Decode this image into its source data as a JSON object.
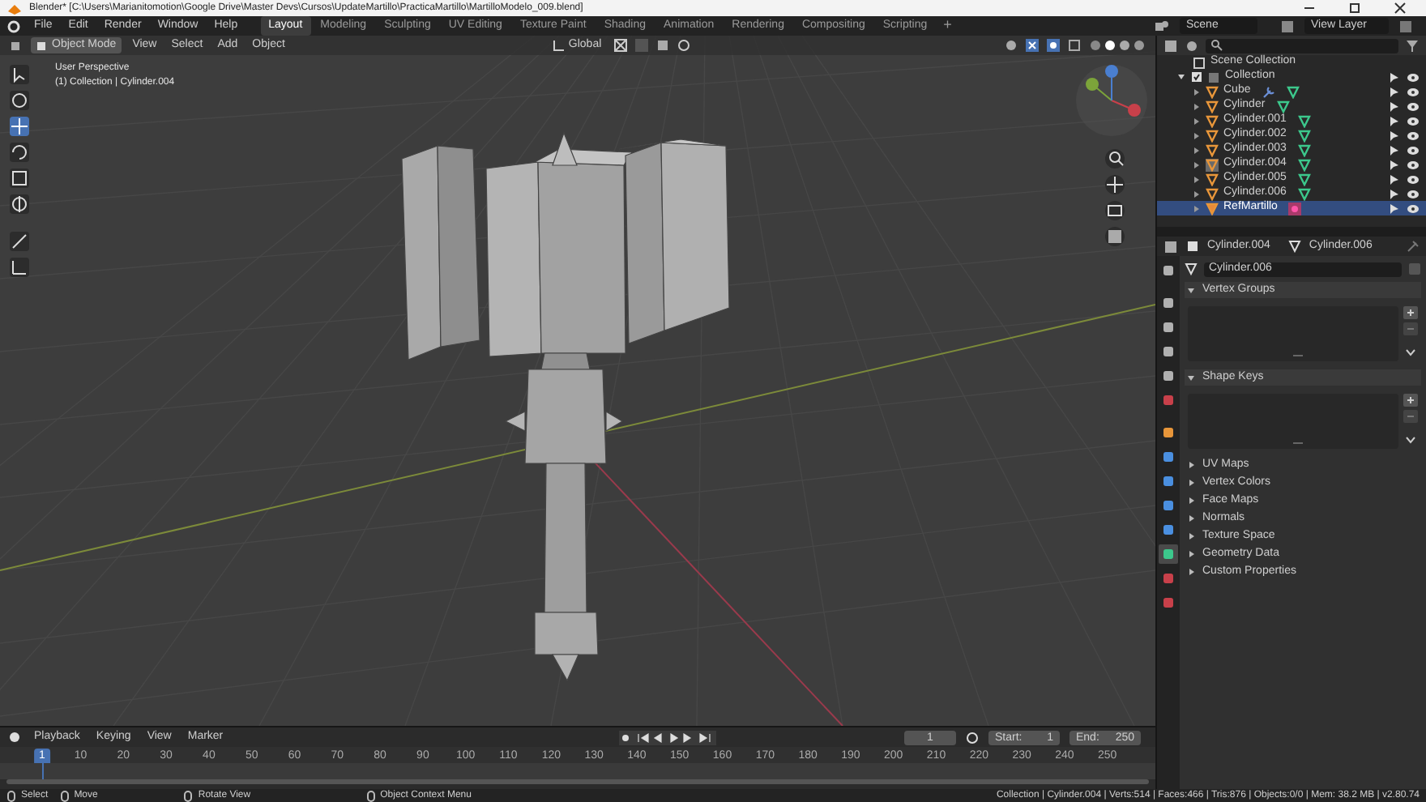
{
  "window": {
    "title": "Blender* [C:\\Users\\Marianitomotion\\Google Drive\\Master Devs\\Cursos\\UpdateMartillo\\PracticaMartillo\\MartilloModelo_009.blend]"
  },
  "menu": [
    "File",
    "Edit",
    "Render",
    "Window",
    "Help"
  ],
  "workspaces": [
    {
      "label": "Layout",
      "selected": true
    },
    {
      "label": "Modeling",
      "selected": false
    },
    {
      "label": "Sculpting",
      "selected": false
    },
    {
      "label": "UV Editing",
      "selected": false
    },
    {
      "label": "Texture Paint",
      "selected": false
    },
    {
      "label": "Shading",
      "selected": false
    },
    {
      "label": "Animation",
      "selected": false
    },
    {
      "label": "Rendering",
      "selected": false
    },
    {
      "label": "Compositing",
      "selected": false
    },
    {
      "label": "Scripting",
      "selected": false
    }
  ],
  "add_workspace": "+",
  "scene": "Scene",
  "view_layer": "View Layer",
  "viewport": {
    "mode": "Object Mode",
    "menus": [
      "View",
      "Select",
      "Add",
      "Object"
    ],
    "orientation": "Global",
    "overlay_lines": [
      "User Perspective",
      "(1) Collection | Cylinder.004"
    ],
    "tools": [
      {
        "selected": false
      },
      {
        "selected": false
      },
      {
        "selected": true
      },
      {
        "selected": false
      },
      {
        "selected": false
      },
      {
        "selected": false
      },
      {
        "selected": false
      },
      {
        "selected": false
      }
    ]
  },
  "outliner": {
    "root": "Scene Collection",
    "collection": "Collection",
    "items": [
      {
        "label": "Cube",
        "modifier": true,
        "active": false,
        "selected": false
      },
      {
        "label": "Cylinder",
        "modifier": false,
        "active": false,
        "selected": false
      },
      {
        "label": "Cylinder.001",
        "modifier": false,
        "active": false,
        "selected": false
      },
      {
        "label": "Cylinder.002",
        "modifier": false,
        "active": false,
        "selected": false
      },
      {
        "label": "Cylinder.003",
        "modifier": false,
        "active": false,
        "selected": false
      },
      {
        "label": "Cylinder.004",
        "modifier": false,
        "active": true,
        "selected": false
      },
      {
        "label": "Cylinder.005",
        "modifier": false,
        "active": false,
        "selected": false
      },
      {
        "label": "Cylinder.006",
        "modifier": false,
        "active": false,
        "selected": false
      },
      {
        "label": "RefMartillo",
        "modifier": false,
        "active": false,
        "selected": true
      }
    ]
  },
  "properties": {
    "breadcrumb": [
      "Cylinder.004",
      "Cylinder.006"
    ],
    "data_name": "Cylinder.006",
    "tabs": [
      {
        "color": "#b0b0b0",
        "selected": false
      },
      {
        "color": "#b0b0b0",
        "selected": false
      },
      {
        "color": "#b0b0b0",
        "selected": false
      },
      {
        "color": "#b0b0b0",
        "selected": false
      },
      {
        "color": "#b0b0b0",
        "selected": false
      },
      {
        "color": "#c8404a",
        "selected": false
      },
      {
        "color": "#e8963a",
        "selected": false
      },
      {
        "color": "#4a8fe0",
        "selected": false
      },
      {
        "color": "#4a8fe0",
        "selected": false
      },
      {
        "color": "#4a8fe0",
        "selected": false
      },
      {
        "color": "#4a8fe0",
        "selected": false
      },
      {
        "color": "#3cc88c",
        "selected": true
      },
      {
        "color": "#c8404a",
        "selected": false
      },
      {
        "color": "#c8404a",
        "selected": false
      }
    ],
    "panels": [
      {
        "label": "Vertex Groups",
        "expanded": true
      },
      {
        "label": "Shape Keys",
        "expanded": true
      },
      {
        "label": "UV Maps",
        "expanded": false
      },
      {
        "label": "Vertex Colors",
        "expanded": false
      },
      {
        "label": "Face Maps",
        "expanded": false
      },
      {
        "label": "Normals",
        "expanded": false
      },
      {
        "label": "Texture Space",
        "expanded": false
      },
      {
        "label": "Geometry Data",
        "expanded": false
      },
      {
        "label": "Custom Properties",
        "expanded": false
      }
    ]
  },
  "timeline": {
    "menus": [
      "Playback",
      "Keying",
      "View",
      "Marker"
    ],
    "current_frame": "1",
    "start_label": "Start:",
    "start": "1",
    "end_label": "End:",
    "end": "250",
    "ticks": [
      "1",
      "10",
      "20",
      "30",
      "40",
      "50",
      "60",
      "70",
      "80",
      "90",
      "100",
      "110",
      "120",
      "130",
      "140",
      "150",
      "160",
      "170",
      "180",
      "190",
      "200",
      "210",
      "220",
      "230",
      "240",
      "250"
    ]
  },
  "status_bar": {
    "hints": [
      "Select",
      "Move",
      "Rotate View",
      "Object Context Menu"
    ],
    "stats": "Collection | Cylinder.004 | Verts:514 | Faces:466 | Tris:876 | Objects:0/0 | Mem: 38.2 MB | v2.80.74"
  }
}
